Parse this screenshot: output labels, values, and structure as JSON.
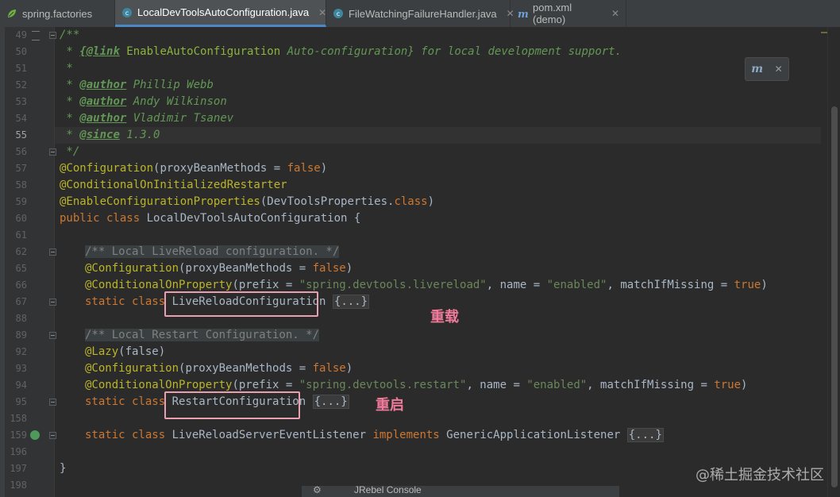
{
  "tabs": [
    {
      "label": "spring.factories",
      "icon": "spring-leaf-icon",
      "active": false
    },
    {
      "label": "LocalDevToolsAutoConfiguration.java",
      "icon": "java-class-icon",
      "active": true
    },
    {
      "label": "FileWatchingFailureHandler.java",
      "icon": "java-class-icon",
      "active": false
    },
    {
      "label": "pom.xml (demo)",
      "icon": "maven-icon",
      "active": false
    }
  ],
  "tab_close": "✕",
  "line_numbers": [
    "49",
    "50",
    "51",
    "52",
    "53",
    "54",
    "55",
    "56",
    "57",
    "58",
    "59",
    "60",
    "61",
    "62",
    "65",
    "66",
    "67",
    "88",
    "89",
    "92",
    "93",
    "94",
    "95",
    "158",
    "159",
    "196",
    "197",
    "198"
  ],
  "current_line": "55",
  "code": {
    "l49": "/**",
    "l50": [
      " * ",
      "{@link",
      " EnableAutoConfiguration",
      " Auto-configuration}",
      " for local development support."
    ],
    "l51": " *",
    "l52": [
      " * ",
      "@author",
      " Phillip Webb"
    ],
    "l53": [
      " * ",
      "@author",
      " Andy Wilkinson"
    ],
    "l54": [
      " * ",
      "@author",
      " Vladimir Tsanev"
    ],
    "l55": [
      " * ",
      "@since",
      " 1.3.0"
    ],
    "l56": " */",
    "l57": [
      "@Configuration",
      "(proxyBeanMethods = ",
      "false",
      ")"
    ],
    "l58": "@ConditionalOnInitializedRestarter",
    "l59": [
      "@EnableConfigurationProperties",
      "(DevToolsProperties.",
      "class",
      ")"
    ],
    "l60": [
      "public class ",
      "LocalDevToolsAutoConfiguration {"
    ],
    "l62": "/** Local LiveReload configuration. */",
    "l65": [
      "@Configuration",
      "(proxyBeanMethods = ",
      "false",
      ")"
    ],
    "l66": [
      "@ConditionalOnProperty",
      "(prefix = ",
      "\"spring.devtools.livereload\"",
      ", name = ",
      "\"enabled\"",
      ", matchIfMissing = ",
      "true",
      ")"
    ],
    "l67": [
      "static class ",
      "LiveReloadConfiguration",
      " ",
      "{...}"
    ],
    "l89": "/** Local Restart Configuration. */",
    "l92": [
      "@Lazy",
      "(false)"
    ],
    "l93": [
      "@Configuration",
      "(proxyBeanMethods = ",
      "false",
      ")"
    ],
    "l94": [
      "@ConditionalOnProperty",
      "(prefix = ",
      "\"spring.devtools.restart\"",
      ", name = ",
      "\"enabled\"",
      ", matchIfMissing = ",
      "true",
      ")"
    ],
    "l95": [
      "static class ",
      "RestartConfiguration",
      " ",
      "{...}"
    ],
    "l159": [
      "static class ",
      "LiveReloadServerEventListener ",
      "implements ",
      "GenericApplicationListener ",
      "{...}"
    ],
    "l197": "}"
  },
  "annotations": {
    "reload_label": "重载",
    "restart_label": "重启",
    "highlight_color": "#e8a0b0",
    "label_color": "#f07a9a"
  },
  "popup": {
    "icon": "maven-reload-icon",
    "glyph": "m",
    "close": "✕"
  },
  "statusbar": {
    "gear": "⚙",
    "text": "JRebel Console"
  },
  "watermark": "@稀土掘金技术社区"
}
